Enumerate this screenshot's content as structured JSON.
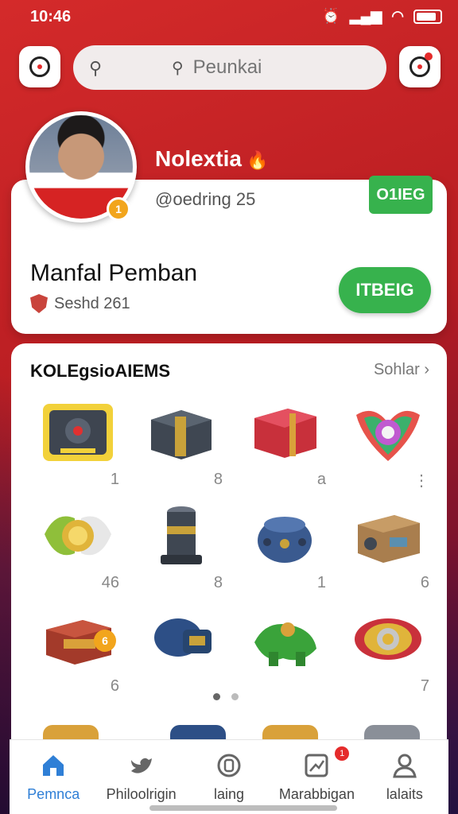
{
  "status_bar": {
    "time": "10:46"
  },
  "search": {
    "placeholder": "Peunkai"
  },
  "profile": {
    "name": "Nolextia",
    "name_emoji": "🔥",
    "handle": "@oedring 25",
    "avatar_badge": "1",
    "tag": "O1IEG"
  },
  "summary": {
    "title": "Manfal Pemban",
    "subtitle": "Seshd 261",
    "action_label": "ITBEIG"
  },
  "collection": {
    "title": "KOLEgsioAIEMS",
    "more_label": "Sohlar",
    "items": [
      {
        "name": "gear-box",
        "count": "1"
      },
      {
        "name": "metal-chest",
        "count": "8"
      },
      {
        "name": "red-treasure-box",
        "count": "a"
      },
      {
        "name": "rainbow-wing-badge",
        "count": "⋮"
      },
      {
        "name": "green-winged-coin",
        "count": "46"
      },
      {
        "name": "steel-pillar",
        "count": "8"
      },
      {
        "name": "blue-pot",
        "count": "1"
      },
      {
        "name": "wooden-device",
        "count": "6"
      },
      {
        "name": "red-toolbox",
        "count": "6"
      },
      {
        "name": "blue-drum",
        "count": ""
      },
      {
        "name": "green-creature",
        "count": ""
      },
      {
        "name": "golden-shield",
        "count": "7"
      }
    ]
  },
  "nav": {
    "items": [
      {
        "label": "Pemnca",
        "icon": "home-icon"
      },
      {
        "label": "Philoolrigin",
        "icon": "bird-icon"
      },
      {
        "label": "laing",
        "icon": "tag-icon"
      },
      {
        "label": "Marabbigan",
        "icon": "activity-icon",
        "badge": "1"
      },
      {
        "label": "lalaits",
        "icon": "user-icon"
      }
    ]
  },
  "colors": {
    "accent_green": "#37b24d",
    "brand_red": "#d42a2a",
    "nav_active": "#2f7fd6"
  }
}
